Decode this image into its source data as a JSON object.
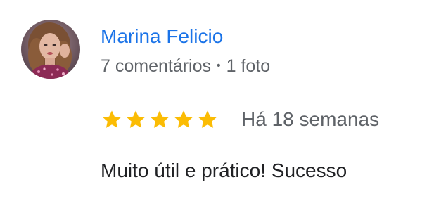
{
  "review": {
    "author": {
      "name": "Marina Felicio",
      "reviews_count_label": "7 comentários",
      "separator": "•",
      "photos_count_label": "1 foto"
    },
    "rating": {
      "value": 5,
      "max": 5,
      "star_color": "#fbbc04",
      "star_icon": "star-icon"
    },
    "date_label": "Há 18 semanas",
    "text": "Muito útil e prático! Sucesso"
  },
  "colors": {
    "name_link": "#1a73e8",
    "secondary_text": "#5f6368",
    "body_text": "#202124"
  }
}
